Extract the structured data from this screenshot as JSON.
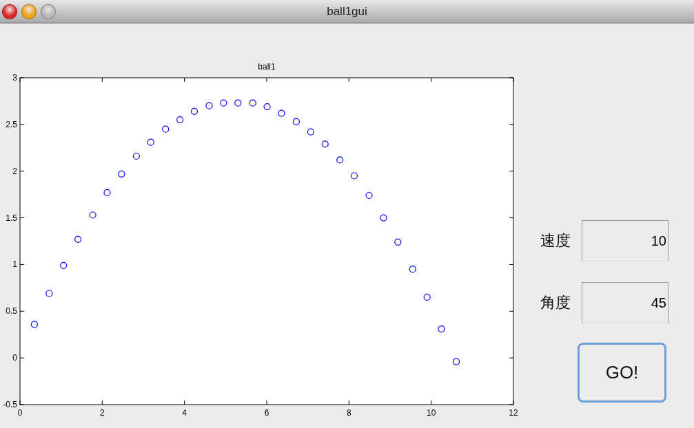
{
  "window": {
    "title": "ball1gui"
  },
  "plot": {
    "chart_data": {
      "type": "scatter",
      "title": "ball1",
      "xlim": [
        0,
        12
      ],
      "ylim": [
        -0.5,
        3
      ],
      "xticks": [
        0,
        2,
        4,
        6,
        8,
        10,
        12
      ],
      "yticks": [
        -0.5,
        0,
        0.5,
        1,
        1.5,
        2,
        2.5,
        3
      ],
      "series": [
        {
          "color": "#0000ff",
          "x": [
            0.35,
            0.71,
            1.06,
            1.41,
            1.77,
            2.12,
            2.47,
            2.83,
            3.18,
            3.54,
            3.89,
            4.24,
            4.6,
            4.95,
            5.3,
            5.66,
            6.01,
            6.36,
            6.72,
            7.07,
            7.42,
            7.78,
            8.13,
            8.49,
            8.84,
            9.19,
            9.55,
            9.9,
            10.25,
            10.61
          ],
          "values": [
            0.36,
            0.69,
            0.99,
            1.27,
            1.53,
            1.77,
            1.97,
            2.16,
            2.31,
            2.45,
            2.55,
            2.64,
            2.7,
            2.73,
            2.73,
            2.73,
            2.69,
            2.62,
            2.53,
            2.42,
            2.29,
            2.12,
            1.95,
            1.74,
            1.5,
            1.24,
            0.95,
            0.65,
            0.31,
            -0.04
          ]
        }
      ]
    }
  },
  "inputs": [
    {
      "label": "速度",
      "value": "10"
    },
    {
      "label": "角度",
      "value": "45"
    }
  ],
  "button": {
    "label": "GO!"
  }
}
